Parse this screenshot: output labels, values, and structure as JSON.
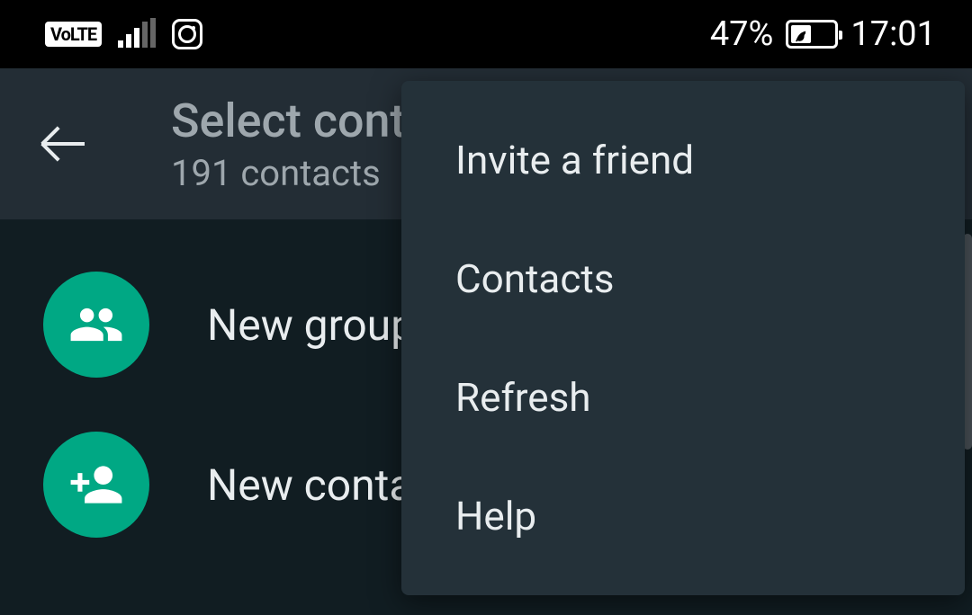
{
  "status_bar": {
    "volte_label": "VoLTE",
    "battery_percent": "47%",
    "time": "17:01"
  },
  "header": {
    "title": "Select contact",
    "subtitle": "191 contacts"
  },
  "list": {
    "items": [
      {
        "label": "New group",
        "icon": "group-icon"
      },
      {
        "label": "New contact",
        "icon": "add-person-icon"
      }
    ]
  },
  "menu": {
    "items": [
      {
        "label": "Invite a friend"
      },
      {
        "label": "Contacts"
      },
      {
        "label": "Refresh"
      },
      {
        "label": "Help"
      }
    ]
  },
  "colors": {
    "accent": "#00a884",
    "bg_dark": "#111d22",
    "bg_header": "#232d35",
    "bg_menu": "#243139",
    "text_primary": "#e9edef",
    "text_secondary": "#9ea7ad"
  }
}
